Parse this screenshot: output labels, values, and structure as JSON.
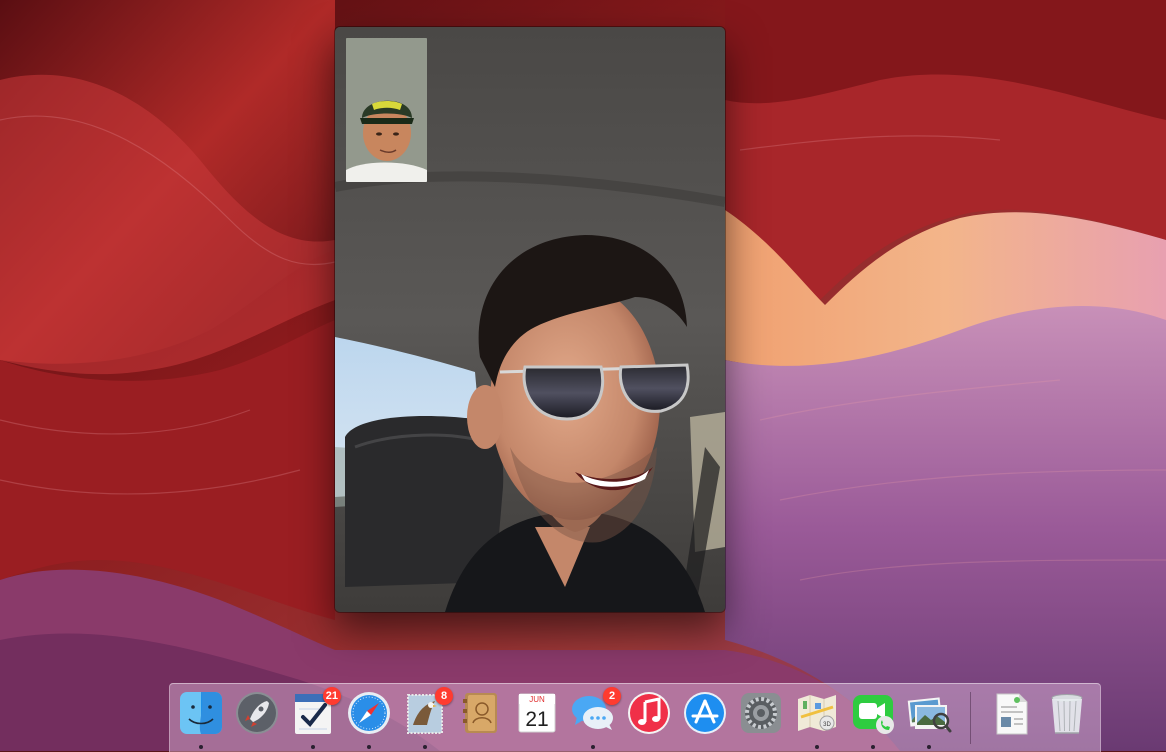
{
  "facetime": {
    "remote_video": "remote-caller-video",
    "self_preview": "self-camera-preview"
  },
  "dock": {
    "items": [
      {
        "name": "Finder",
        "icon": "finder-icon",
        "running": true
      },
      {
        "name": "Launchpad",
        "icon": "rocket-icon",
        "running": false
      },
      {
        "name": "Reminders",
        "icon": "reminders-checklist-icon",
        "badge": "21",
        "running": true
      },
      {
        "name": "Safari",
        "icon": "compass-icon",
        "running": true
      },
      {
        "name": "Mail",
        "icon": "stamp-eagle-icon",
        "badge": "8",
        "running": true
      },
      {
        "name": "Contacts",
        "icon": "address-book-icon",
        "running": false
      },
      {
        "name": "Calendar",
        "icon": "calendar-icon",
        "month": "JUN",
        "day": "21",
        "running": false
      },
      {
        "name": "Messages",
        "icon": "speech-bubbles-icon",
        "badge": "2",
        "running": true
      },
      {
        "name": "iTunes",
        "icon": "music-note-icon",
        "running": false
      },
      {
        "name": "App Store",
        "icon": "app-store-icon",
        "running": false
      },
      {
        "name": "System Preferences",
        "icon": "gear-icon",
        "running": false
      },
      {
        "name": "Maps",
        "icon": "map-icon",
        "running": true
      },
      {
        "name": "FaceTime",
        "icon": "video-camera-phone-icon",
        "running": true
      },
      {
        "name": "Preview",
        "icon": "photos-magnifier-icon",
        "running": true
      },
      {
        "name": "Document",
        "icon": "document-icon",
        "running": false
      },
      {
        "name": "Trash",
        "icon": "trash-icon",
        "running": false
      }
    ]
  },
  "colors": {
    "wallpaper_red": "#8a1a1c",
    "wallpaper_purple": "#8a4a86",
    "badge": "#ff3b30",
    "facetime_green": "#2ecc40"
  }
}
